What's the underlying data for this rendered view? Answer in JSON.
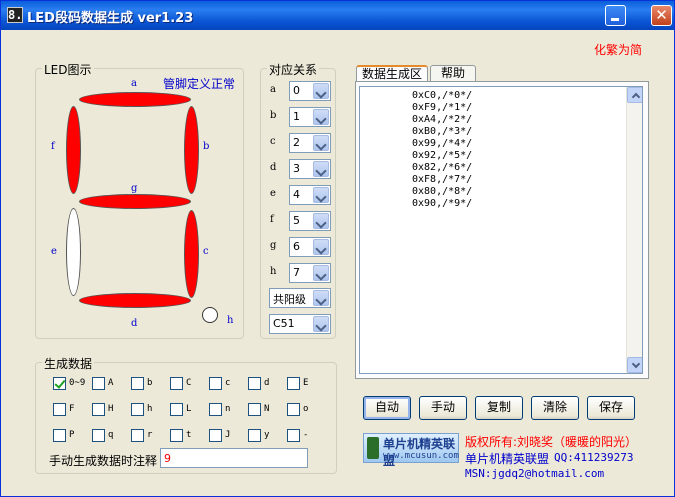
{
  "window": {
    "icon_glyph": "8.",
    "title": "LED段码数据生成 ver1.23",
    "minimize_icon": "minimize-icon",
    "close_glyph": "✕"
  },
  "top_link": "化繁为简",
  "led_display": {
    "group_title": "LED图示",
    "status": "管脚定义正常",
    "segments": [
      {
        "id": "a",
        "label": "a",
        "on": true
      },
      {
        "id": "b",
        "label": "b",
        "on": true
      },
      {
        "id": "c",
        "label": "c",
        "on": true
      },
      {
        "id": "d",
        "label": "d",
        "on": true
      },
      {
        "id": "e",
        "label": "e",
        "on": false
      },
      {
        "id": "f",
        "label": "f",
        "on": true
      },
      {
        "id": "g",
        "label": "g",
        "on": true
      },
      {
        "id": "h",
        "label": "h",
        "on": false
      }
    ]
  },
  "pin_mapping": {
    "group_title": "对应关系",
    "rows": [
      {
        "label": "a",
        "value": "0"
      },
      {
        "label": "b",
        "value": "1"
      },
      {
        "label": "c",
        "value": "2"
      },
      {
        "label": "d",
        "value": "3"
      },
      {
        "label": "e",
        "value": "4"
      },
      {
        "label": "f",
        "value": "5"
      },
      {
        "label": "g",
        "value": "6"
      },
      {
        "label": "h",
        "value": "7"
      }
    ],
    "polarity": "共阳级",
    "compiler": "C51"
  },
  "tabs": [
    {
      "label": "数据生成区",
      "active": true
    },
    {
      "label": "帮助",
      "active": false
    }
  ],
  "output": {
    "lines": [
      "0xC0,/*0*/",
      "0xF9,/*1*/",
      "0xA4,/*2*/",
      "0xB0,/*3*/",
      "0x99,/*4*/",
      "0x92,/*5*/",
      "0x82,/*6*/",
      "0xF8,/*7*/",
      "0x80,/*8*/",
      "0x90,/*9*/"
    ]
  },
  "generate_data": {
    "group_title": "生成数据",
    "checkboxes": [
      {
        "label": "0~9",
        "checked": true
      },
      {
        "label": "A",
        "checked": false
      },
      {
        "label": "b",
        "checked": false
      },
      {
        "label": "C",
        "checked": false
      },
      {
        "label": "c",
        "checked": false
      },
      {
        "label": "d",
        "checked": false
      },
      {
        "label": "E",
        "checked": false
      },
      {
        "label": "F",
        "checked": false
      },
      {
        "label": "H",
        "checked": false
      },
      {
        "label": "h",
        "checked": false
      },
      {
        "label": "L",
        "checked": false
      },
      {
        "label": "n",
        "checked": false
      },
      {
        "label": "N",
        "checked": false
      },
      {
        "label": "o",
        "checked": false
      },
      {
        "label": "P",
        "checked": false
      },
      {
        "label": "q",
        "checked": false
      },
      {
        "label": "r",
        "checked": false
      },
      {
        "label": "t",
        "checked": false
      },
      {
        "label": "J",
        "checked": false
      },
      {
        "label": "y",
        "checked": false
      },
      {
        "label": "-",
        "checked": false
      }
    ],
    "note_label": "手动生成数据时注释",
    "note_value": "9"
  },
  "buttons": {
    "auto": "自动",
    "manual": "手动",
    "copy": "复制",
    "clear": "清除",
    "save": "保存"
  },
  "footer": {
    "logo_text": "单片机精英联盟",
    "logo_url": "www.mcusun.com",
    "copyright": "版权所有:刘晓奖（暖暖的阳光）",
    "org": "单片机精英联盟",
    "qq": "QQ:411239273",
    "msn": "MSN:jgdq2@hotmail.com"
  },
  "colors": {
    "segment_on": "#ff0000",
    "segment_off": "#ffffff",
    "label_blue": "#0000cc",
    "accent_red": "#ff0000"
  }
}
